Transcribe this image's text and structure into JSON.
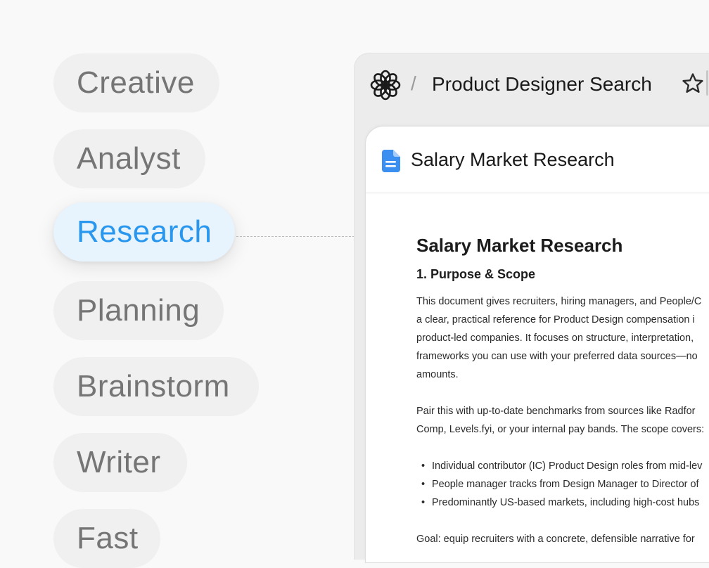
{
  "modes": {
    "items": [
      {
        "label": "Creative"
      },
      {
        "label": "Analyst"
      },
      {
        "label": "Research"
      },
      {
        "label": "Planning"
      },
      {
        "label": "Brainstorm"
      },
      {
        "label": "Writer"
      },
      {
        "label": "Fast"
      }
    ],
    "active": "Research"
  },
  "header": {
    "separator": "/",
    "title": "Product Designer Search"
  },
  "document": {
    "tab_title": "Salary Market Research",
    "heading": "Salary Market Research",
    "section_heading": "1. Purpose & Scope",
    "paragraph1_lines": [
      "This document gives recruiters, hiring managers, and People/C",
      "a clear, practical reference for Product Design compensation i",
      "product-led companies. It focuses on structure, interpretation,",
      "frameworks you can use with your preferred data sources—no",
      "amounts."
    ],
    "paragraph2_lines": [
      "Pair this with up-to-date benchmarks from sources like Radfor",
      "Comp, Levels.fyi, or your internal pay bands. The scope covers:"
    ],
    "bullets": [
      "Individual contributor (IC) Product Design roles from mid-lev",
      "People manager tracks from Design Manager to Director of",
      "Predominantly US-based markets, including high-cost hubs"
    ],
    "goal_line": "Goal: equip recruiters with a concrete, defensible narrative for"
  },
  "colors": {
    "accent": "#2a97ee",
    "active_pill_bg": "#e7f3fd",
    "doc_icon": "#3b8ff0"
  }
}
